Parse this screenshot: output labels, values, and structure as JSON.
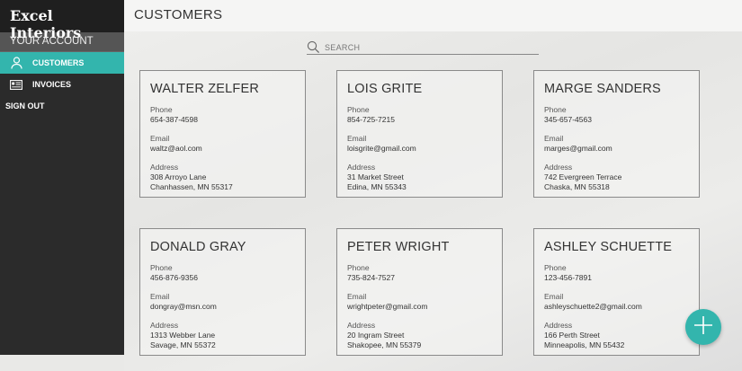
{
  "brand": "Excel Interiors",
  "sidebar": {
    "section_label": "YOUR ACCOUNT",
    "items": [
      {
        "label": "CUSTOMERS",
        "icon": "user-icon",
        "active": true
      },
      {
        "label": "INVOICES",
        "icon": "invoice-icon",
        "active": false
      }
    ],
    "signout_label": "SIGN OUT"
  },
  "header": {
    "title": "CUSTOMERS"
  },
  "search": {
    "placeholder": "SEARCH",
    "value": ""
  },
  "labels": {
    "phone": "Phone",
    "email": "Email",
    "address": "Address"
  },
  "customers": [
    {
      "name": "WALTER ZELFER",
      "phone": "654-387-4598",
      "email": "waltz@aol.com",
      "address_line1": "308 Arroyo Lane",
      "address_line2": "Chanhassen, MN 55317"
    },
    {
      "name": "LOIS GRITE",
      "phone": "854-725-7215",
      "email": "loisgrite@gmail.com",
      "address_line1": "31 Market Street",
      "address_line2": "Edina, MN 55343"
    },
    {
      "name": "MARGE SANDERS",
      "phone": "345-657-4563",
      "email": "marges@gmail.com",
      "address_line1": "742 Evergreen Terrace",
      "address_line2": "Chaska, MN 55318"
    },
    {
      "name": "DONALD GRAY",
      "phone": "456-876-9356",
      "email": "dongray@msn.com",
      "address_line1": "1313 Webber Lane",
      "address_line2": "Savage, MN 55372"
    },
    {
      "name": "PETER WRIGHT",
      "phone": "735-824-7527",
      "email": "wrightpeter@gmail.com",
      "address_line1": "20 Ingram Street",
      "address_line2": "Shakopee, MN 55379"
    },
    {
      "name": "ASHLEY SCHUETTE",
      "phone": "123-456-7891",
      "email": "ashleyschuette2@gmail.com",
      "address_line1": "166 Perth Street",
      "address_line2": "Minneapolis, MN 55432"
    }
  ],
  "colors": {
    "accent": "#33b5ad",
    "sidebar": "#2b2b2b",
    "brand_bar": "#1f1f1f",
    "section": "#555555"
  },
  "fab_icon": "plus-icon"
}
